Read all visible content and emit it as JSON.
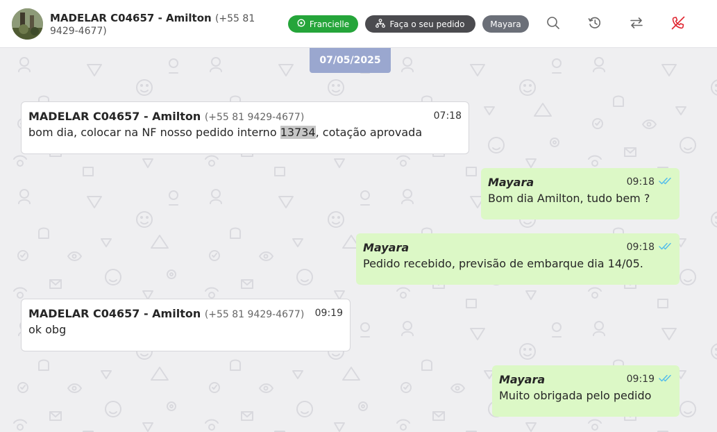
{
  "header": {
    "contact_name": "MADELAR C04657 - Amilton",
    "contact_phone": "(+55 81 9429-4677)",
    "tags": {
      "whatsapp_label": "Francielle",
      "order_label": "Faça o seu pedido",
      "user_label": "Mayara"
    },
    "icons": [
      "search-icon",
      "history-icon",
      "transfer-icon",
      "end-call-icon"
    ]
  },
  "chat": {
    "date_separator": "07/05/2025",
    "messages": [
      {
        "direction": "in",
        "sender": "MADELAR C04657 - Amilton",
        "phone": "(+55 81 9429-4677)",
        "time": "07:18",
        "text_before": "bom dia, colocar na NF nosso pedido interno ",
        "text_highlight": "13734",
        "text_after": ", cotação aprovada"
      },
      {
        "direction": "out",
        "sender": "Mayara",
        "time": "09:18",
        "text": "Bom dia Amilton, tudo bem ?"
      },
      {
        "direction": "out",
        "sender": "Mayara",
        "time": "09:18",
        "text": "Pedido recebido, previsão de embarque dia 14/05."
      },
      {
        "direction": "in",
        "sender": "MADELAR C04657 - Amilton",
        "phone": "(+55 81 9429-4677)",
        "time": "09:19",
        "text": "ok obg"
      },
      {
        "direction": "out",
        "sender": "Mayara",
        "time": "09:19",
        "text": "Muito obrigada pelo pedido"
      }
    ]
  },
  "colors": {
    "header_bg": "#ffffff",
    "chat_bg": "#efeff1",
    "incoming_bubble": "#ffffff",
    "outgoing_bubble": "#dcf8c6",
    "date_chip": "#9aa7cf",
    "tag_green": "#25a53a",
    "tag_dark": "#4b4b4f",
    "tag_gray": "#6b6f78",
    "read_ticks": "#53bdeb",
    "end_call_red": "#e0242f"
  }
}
